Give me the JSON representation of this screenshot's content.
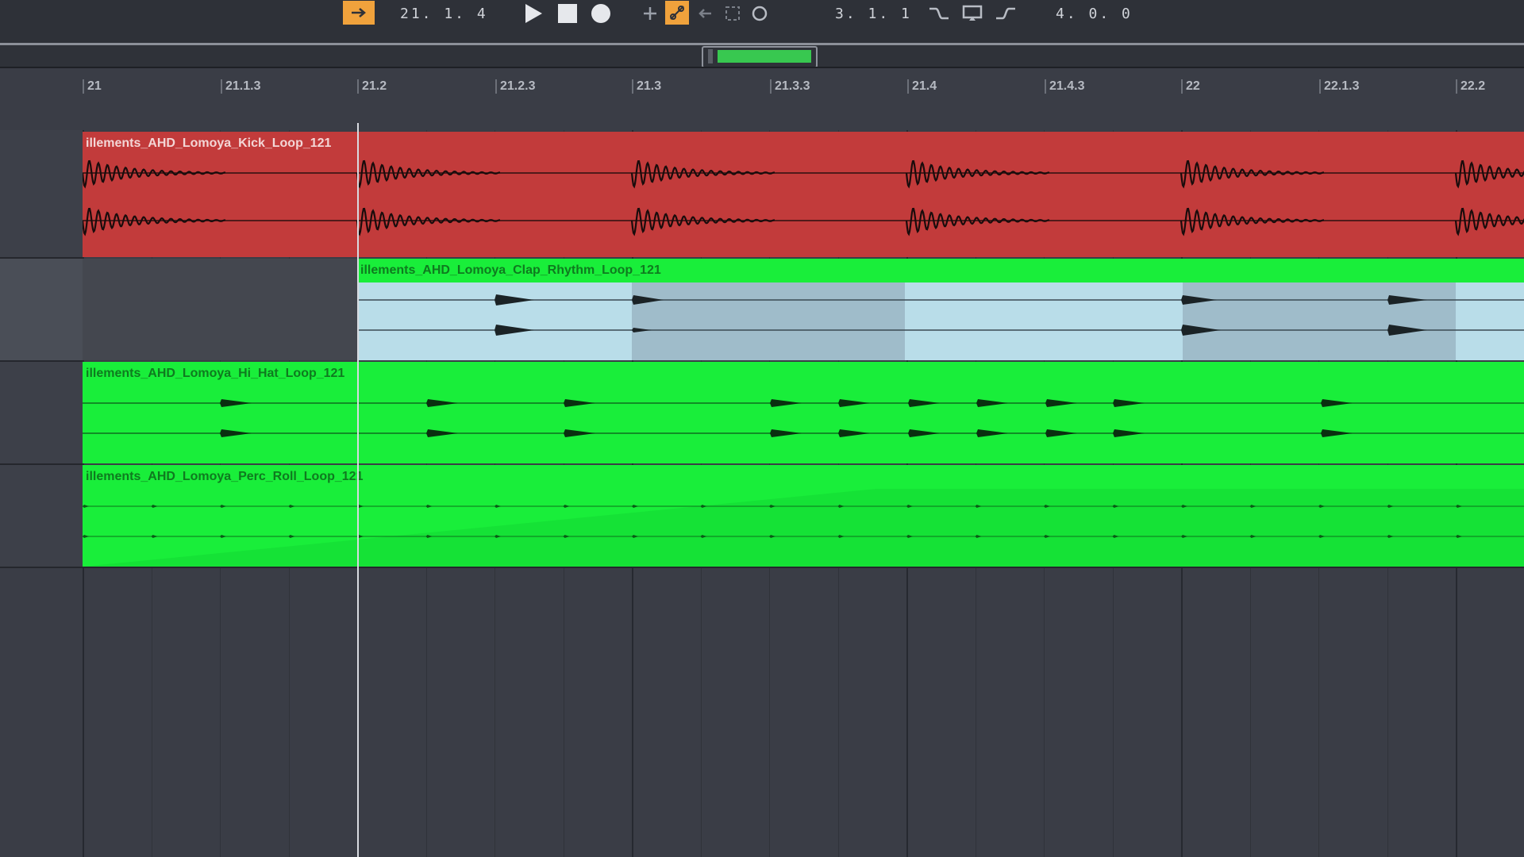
{
  "transport": {
    "position": "21. 1. 4",
    "loop_start": "3. 1. 1",
    "loop_length": "4. 0. 0",
    "icons": [
      "follow-icon",
      "play-icon",
      "stop-icon",
      "record-icon",
      "overdub-icon",
      "automation-arm-icon",
      "reenable-automation-icon",
      "capture-icon",
      "session-record-icon",
      "punch-in-icon",
      "loop-switch-icon",
      "punch-out-icon"
    ]
  },
  "ruler": {
    "labels": [
      "21",
      "21.1.3",
      "21.2",
      "21.2.3",
      "21.3",
      "21.3.3",
      "21.4",
      "21.4.3",
      "22",
      "22.1.3",
      "22.2"
    ]
  },
  "tracks": [
    {
      "name": "illements_AHD_Lomoya_Kick_Loop_121",
      "color": "#c23b3b",
      "title_color": "#f3d6d6"
    },
    {
      "name": "illements_AHD_Lomoya_Clap_Rhythm_Loop_121",
      "color": "#19ee3a",
      "title_color": "#0f7a1f"
    },
    {
      "name": "illements_AHD_Lomoya_Hi_Hat_Loop_121",
      "color": "#19ee3a",
      "title_color": "#0f7a1f"
    },
    {
      "name": "illements_AHD_Lomoya_Perc_Roll_Loop_121",
      "color": "#19ee3a",
      "title_color": "#0f7a1f"
    }
  ],
  "colors": {
    "accent": "#f0a23c",
    "overview_region": "#38c850",
    "clap_body": "#b9dde9"
  }
}
